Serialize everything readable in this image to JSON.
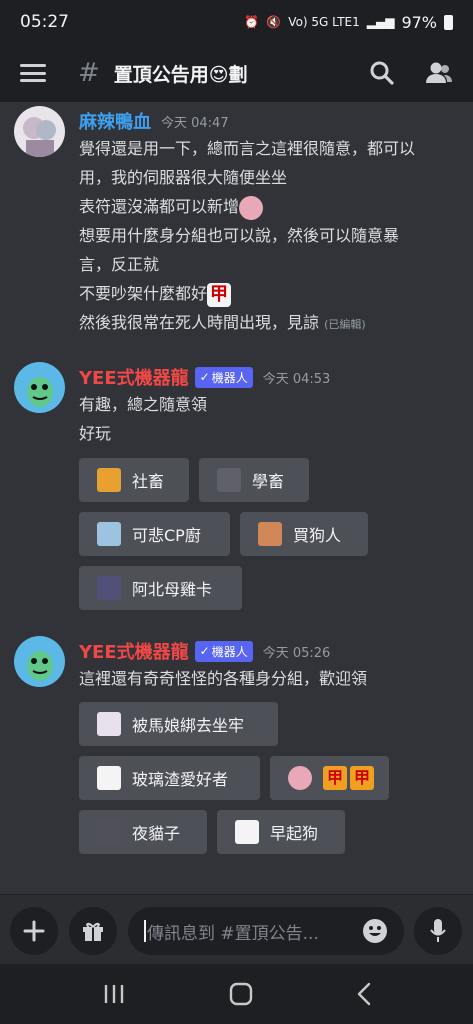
{
  "status": {
    "time": "05:27",
    "network": "Vo) 5G LTE1",
    "battery": "97%"
  },
  "channel": {
    "name": "置頂公告用😍劃"
  },
  "messages": [
    {
      "user": "麻辣鴨血",
      "timestamp": "今天 04:47",
      "lines": [
        "覺得還是用一下，總而言之這裡很隨意，都可以",
        "用，我的伺服器很大隨便坐坐",
        "表符還沒滿都可以新增",
        "想要用什麼身分組也可以說，然後可以隨意暴",
        "言，反正就",
        "不要吵架什麼都好",
        "然後我很常在死人時間出現，見諒"
      ],
      "edited": "(已編輯)",
      "name_color": "#3fa0f0"
    },
    {
      "user": "YEE式機器龍",
      "bot_label": "機器人",
      "timestamp": "今天 04:53",
      "lines": [
        "有趣，總之隨意領",
        "好玩"
      ],
      "name_color": "#f04747",
      "buttons": [
        "社畜",
        "學畜",
        "可悲CP廚",
        "買狗人",
        "阿北母雞卡"
      ]
    },
    {
      "user": "YEE式機器龍",
      "bot_label": "機器人",
      "timestamp": "今天 05:26",
      "lines": [
        "這裡還有奇奇怪怪的各種身分組，歡迎領"
      ],
      "name_color": "#f04747",
      "buttons": [
        "被馬娘綁去坐牢",
        "玻璃渣愛好者",
        "",
        "夜貓子",
        "早起狗"
      ]
    }
  ],
  "composer": {
    "placeholder": "傳訊息到 #置頂公告..."
  }
}
